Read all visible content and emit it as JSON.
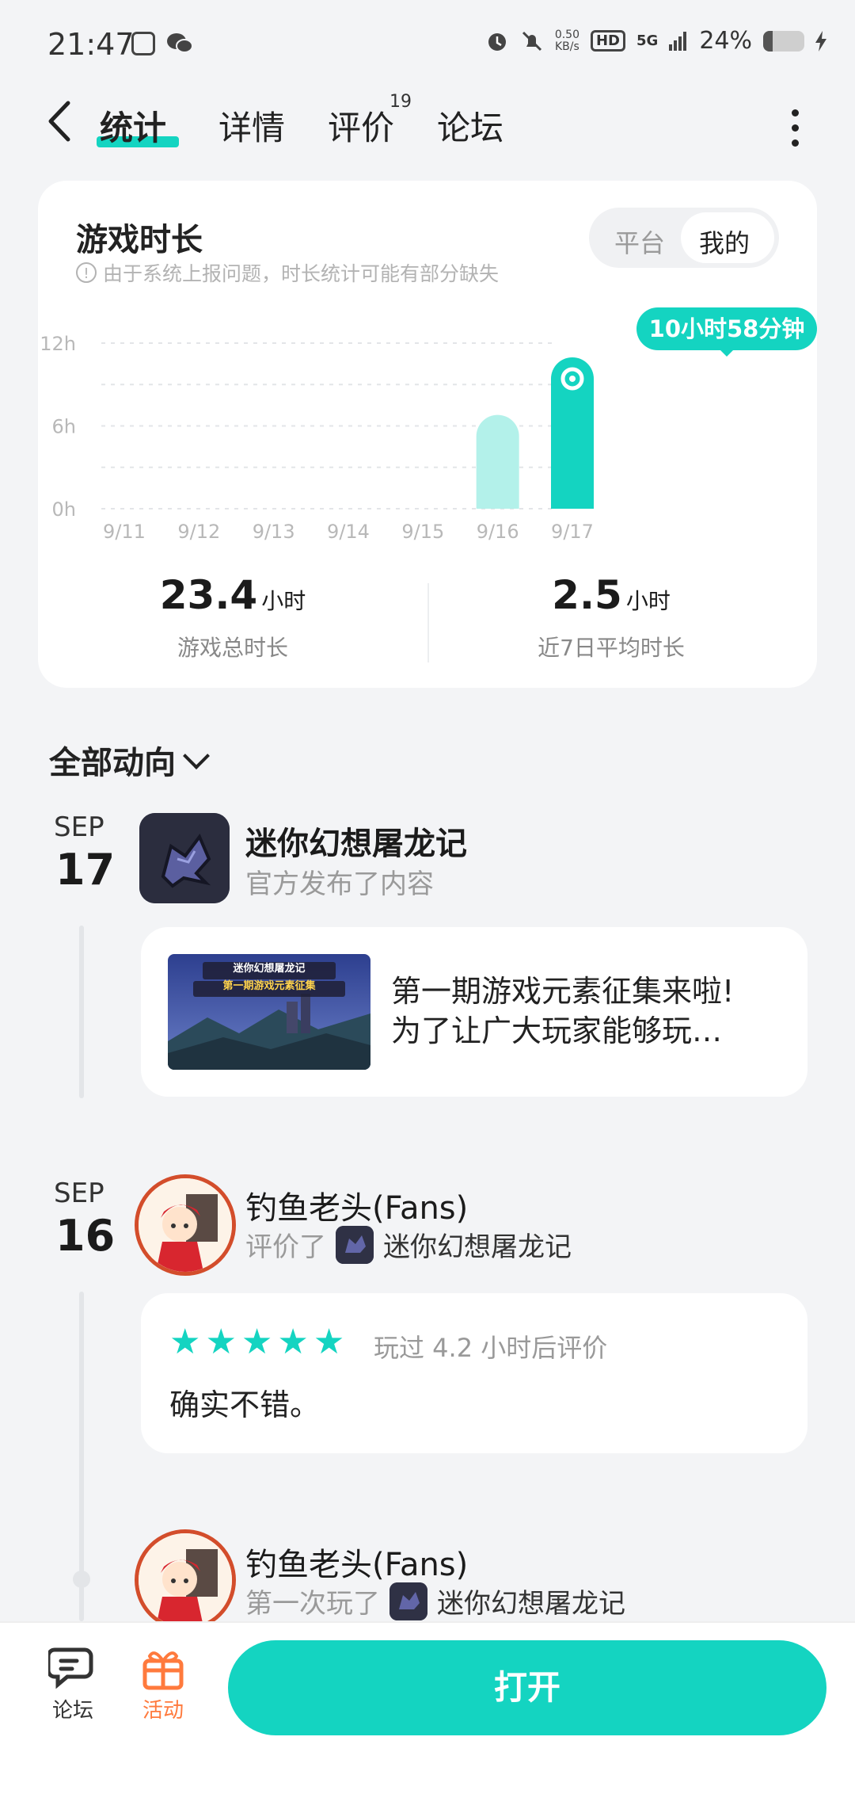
{
  "status_bar": {
    "time": "21:47",
    "net_speed_value": "0.50",
    "net_speed_unit": "KB/s",
    "hd": "HD",
    "network": "5G",
    "battery": "24%",
    "battery_level": 0.24
  },
  "header": {
    "tabs": [
      {
        "label": "统计"
      },
      {
        "label": "详情"
      },
      {
        "label": "评价",
        "badge": "19"
      },
      {
        "label": "论坛"
      }
    ]
  },
  "playtime_card": {
    "title": "游戏时长",
    "note": "由于系统上报问题，时长统计可能有部分缺失",
    "toggle": [
      "平台",
      "我的"
    ],
    "tooltip": "10小时58分钟",
    "stats": [
      {
        "value": "23.4",
        "unit": "小时",
        "label": "游戏总时长"
      },
      {
        "value": "2.5",
        "unit": "小时",
        "label": "近7日平均时长"
      }
    ]
  },
  "chart_data": {
    "type": "bar",
    "categories": [
      "9/11",
      "9/12",
      "9/13",
      "9/14",
      "9/15",
      "9/16",
      "9/17"
    ],
    "values": [
      0,
      0,
      0,
      0,
      0,
      6.8,
      10.97
    ],
    "yticks": [
      "12h",
      "6h",
      "0h"
    ],
    "ylim": [
      0,
      12
    ],
    "highlight_index": 6,
    "colors": {
      "highlight": "#14d4c1",
      "normal": "#b3f1ea"
    },
    "grid": true
  },
  "feed": {
    "filter_label": "全部动向",
    "entries": [
      {
        "month": "SEP",
        "day": "17",
        "title": "迷你幻想屠龙记",
        "action": "官方发布了内容",
        "post_line1": "第一期游戏元素征集来啦!",
        "post_line2": "为了让广大玩家能够玩…",
        "thumb_title": "迷你幻想屠龙记",
        "thumb_subtitle": "第一期游戏元素征集"
      },
      {
        "month": "SEP",
        "day": "16",
        "user": "钓鱼老头(Fans)",
        "action": "评价了",
        "game": "迷你幻想屠龙记",
        "rating": 5,
        "review_meta": "玩过 4.2 小时后评价",
        "review_text": "确实不错。"
      },
      {
        "user": "钓鱼老头(Fans)",
        "action": "第一次玩了",
        "game": "迷你幻想屠龙记"
      }
    ]
  },
  "bottom_bar": {
    "forum_label": "论坛",
    "activity_label": "活动",
    "open_label": "打开"
  }
}
